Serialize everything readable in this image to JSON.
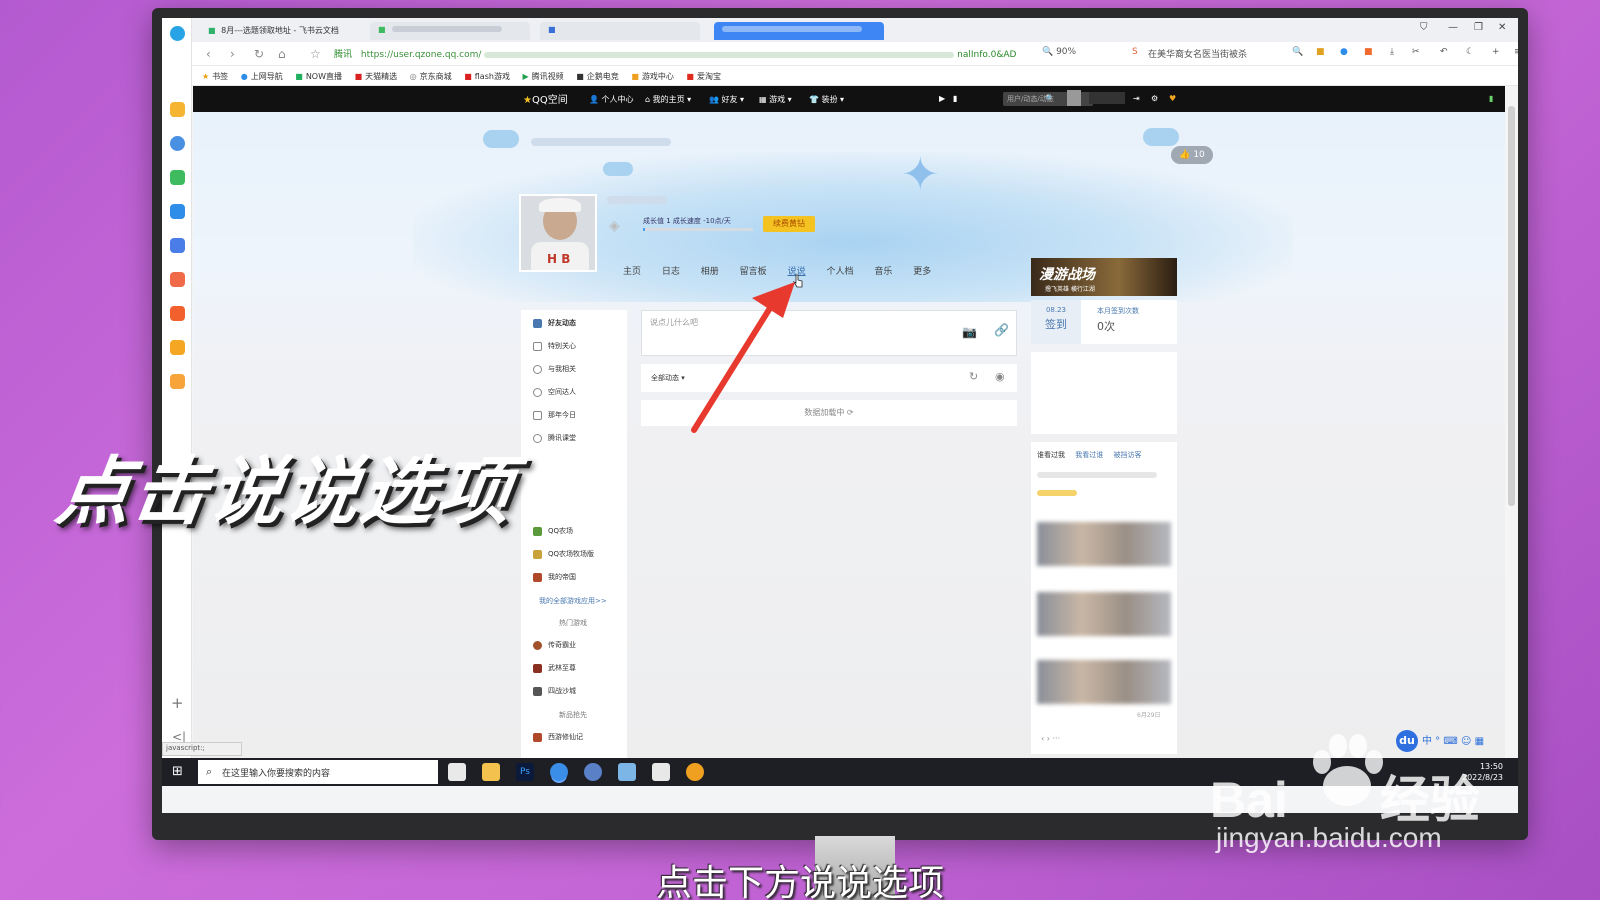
{
  "browser": {
    "tabs": [
      {
        "label": "8月---选题领取地址 - 飞书云文档",
        "active": false
      },
      {
        "label": "",
        "active": false
      },
      {
        "label": "",
        "active": true
      }
    ],
    "url_site": "腾讯",
    "url": "https://user.qzone.qq.com/",
    "url_tail": "nalInfo.0&AD",
    "zoom": "90%",
    "search_hint": "在美华裔女名医当街被杀",
    "bookmarks": [
      "书签",
      "上网导航",
      "NOW直播",
      "天猫精选",
      "京东商城",
      "flash游戏",
      "腾讯视频",
      "企鹅电竞",
      "游戏中心",
      "爱淘宝"
    ],
    "status_link": "javascript:;"
  },
  "qzone_bar": {
    "logo": "QQ空间",
    "items": [
      "个人中心",
      "我的主页",
      "好友",
      "游戏",
      "装扮"
    ],
    "search_placeholder": "用户/动态/动态"
  },
  "profile": {
    "likes": "10",
    "growth_text": "成长值 1  成长速度 -10点/天",
    "growth_percent": 0,
    "vip_button": "续费黄钻",
    "nav": [
      "主页",
      "日志",
      "相册",
      "留言板",
      "说说",
      "个人档",
      "音乐",
      "更多"
    ]
  },
  "left_list": {
    "items": [
      "好友动态",
      "特别关心",
      "与我相关",
      "空间达人",
      "那年今日",
      "腾讯课堂"
    ],
    "apps": [
      "QQ农场",
      "QQ农场牧场版",
      "我的帝国"
    ],
    "all_apps_link": "我的全部游戏应用>>",
    "hot_games_title": "热门游戏",
    "hot_games": [
      "传奇霸业",
      "武林至尊",
      "四战沙城"
    ],
    "new_title": "新品抢先",
    "new_games": [
      "西游修仙记"
    ]
  },
  "feed": {
    "post_placeholder": "说点儿什么吧",
    "filter": "全部动态",
    "loading": "数据加载中"
  },
  "right_panel": {
    "banner_title": "漫游战场",
    "banner_sub": "撸飞英雄 横行江湖",
    "signin_date": "08.23",
    "signin_label": "签到",
    "month_label": "本月签到次数",
    "month_count": "0次",
    "visitor_tabs": [
      "谁看过我",
      "我看过谁",
      "被挡访客"
    ],
    "visitor_date": "6月29日"
  },
  "taskbar": {
    "search_placeholder": "在这里输入你要搜索的内容",
    "time": "13:50",
    "date": "2022/8/23",
    "ime": "中"
  },
  "overlay": {
    "caption": "点击说说选项",
    "subtitle": "点击下方说说选项",
    "watermark_brand": "Bai",
    "watermark_brand_end": "经验",
    "watermark_url": "jingyan.baidu.com"
  },
  "colors": {
    "background": "#c466d6",
    "qzone_bar": "#111111",
    "arrow": "#e8392f",
    "vip": "#f5c321"
  }
}
